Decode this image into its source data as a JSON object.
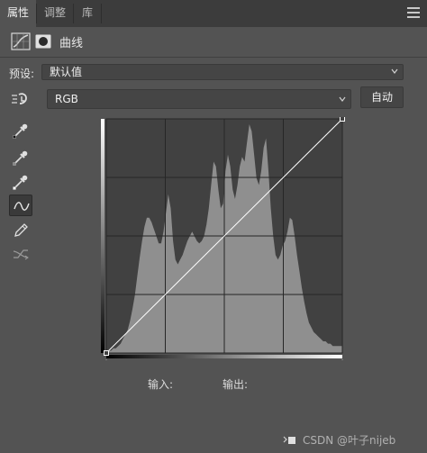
{
  "tabs": [
    {
      "label": "属性",
      "active": true
    },
    {
      "label": "调整",
      "active": false
    },
    {
      "label": "库",
      "active": false
    }
  ],
  "header": {
    "title": "曲线"
  },
  "preset": {
    "label": "预设:",
    "value": "默认值"
  },
  "channel": {
    "value": "RGB"
  },
  "auto_button": {
    "label": "自动"
  },
  "io": {
    "input_label": "输入:",
    "output_label": "输出:"
  },
  "watermark": "CSDN @叶子nijeb",
  "tools": [
    {
      "icon": "on-image-adjust-icon"
    },
    {
      "icon": "black-point-eyedropper-icon"
    },
    {
      "icon": "gray-point-eyedropper-icon"
    },
    {
      "icon": "white-point-eyedropper-icon"
    },
    {
      "icon": "curve-edit-icon"
    },
    {
      "icon": "pencil-icon"
    },
    {
      "icon": "smooth-icon"
    }
  ],
  "colors": {
    "panel": "#535353",
    "tabbar": "#3c3c3c",
    "graph_bg": "#414141",
    "histogram": "#8f8f8f",
    "curve": "#ffffff",
    "text": "#e6e6e6"
  },
  "curve": {
    "points": [
      [
        0,
        0
      ],
      [
        255,
        255
      ]
    ]
  },
  "histogram": {
    "bins": [
      1,
      1,
      1,
      2,
      2,
      3,
      4,
      6,
      8,
      10,
      14,
      19,
      25,
      33,
      41,
      48,
      54,
      58,
      58,
      56,
      53,
      50,
      47,
      47,
      52,
      60,
      68,
      62,
      48,
      40,
      38,
      40,
      42,
      45,
      48,
      50,
      52,
      50,
      48,
      47,
      48,
      50,
      55,
      62,
      72,
      82,
      80,
      70,
      62,
      64,
      78,
      85,
      80,
      70,
      66,
      72,
      80,
      84,
      82,
      90,
      98,
      95,
      85,
      75,
      72,
      78,
      88,
      92,
      78,
      62,
      50,
      42,
      40,
      42,
      46,
      48,
      52,
      58,
      57,
      50,
      42,
      35,
      28,
      22,
      17,
      13,
      11,
      9,
      8,
      7,
      6,
      5,
      5,
      4,
      4,
      3,
      3,
      3,
      3,
      3
    ]
  }
}
